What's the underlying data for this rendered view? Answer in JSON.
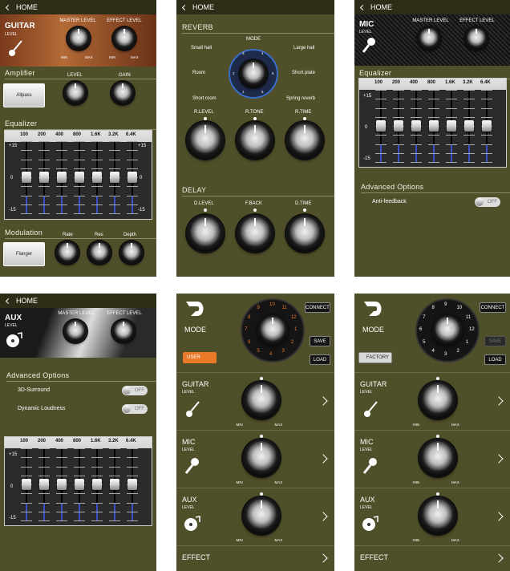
{
  "home": "HOME",
  "level": "LEVEL",
  "min": "MIN",
  "max": "MAX",
  "eq_bands": [
    "100",
    "200",
    "400",
    "800",
    "1.6K",
    "3.2K",
    "6.4K"
  ],
  "eq_scale": [
    "+15",
    "0",
    "-15"
  ],
  "eq_levels": [
    0.5,
    0.5,
    0.5,
    0.5,
    0.5,
    0.5,
    0.5
  ],
  "guitar": {
    "title": "GUITAR",
    "master": "MASTER LEVEL",
    "effect": "EFFECT LEVEL",
    "amplifier": "Amplifier",
    "amp_preset": "Allpass",
    "level_k": "LEVEL",
    "gain_k": "GAIN",
    "equalizer": "Equalizer",
    "modulation": "Modulation",
    "mod_preset": "Flanger",
    "rate": "Rate",
    "res": "Res",
    "depth": "Depth"
  },
  "reverb": {
    "title": "REVERB",
    "mode": "MODE",
    "modes": [
      "Small hall",
      "Large hall",
      "Room",
      "Short plate",
      "Short room",
      "Spring reverb"
    ],
    "dial": [
      "1",
      "2",
      "3",
      "4",
      "5",
      "6"
    ],
    "rlevel": "R.LEVEL",
    "rtone": "R.TONE",
    "rtime": "R.TIME",
    "delay": "DELAY",
    "dlevel": "D.LEVEL",
    "fback": "F.BACK",
    "dtime": "D.TIME"
  },
  "mic": {
    "title": "MIC",
    "master": "MASTER LEVEL",
    "effect": "EFFECT LEVEL",
    "equalizer": "Equalizer",
    "adv": "Advanced Options",
    "anti": "Anti-feedback",
    "off": "OFF"
  },
  "aux": {
    "title": "AUX",
    "master": "MASTER LEVEL",
    "effect": "EFFECT LEVEL",
    "adv": "Advanced Options",
    "surround": "3D-Surround",
    "loudness": "Dynamic Loudness",
    "off": "OFF"
  },
  "main_user": {
    "mode": "MODE",
    "connect": "CONNECT",
    "save": "SAVE",
    "load": "LOAD",
    "user": "USER",
    "dial": [
      "10",
      "11",
      "12",
      "1",
      "2",
      "3",
      "4",
      "5",
      "6",
      "7",
      "8",
      "9"
    ],
    "rows": [
      "GUITAR",
      "MIC",
      "AUX"
    ],
    "effect": "EFFECT"
  },
  "main_factory": {
    "mode": "MODE",
    "connect": "CONNECT",
    "save": "SAVE",
    "load": "LOAD",
    "factory": "FACTORY",
    "dial": [
      "9",
      "10",
      "11",
      "12",
      "1",
      "2",
      "3",
      "4",
      "5",
      "6",
      "7",
      "8"
    ],
    "rows": [
      "GUITAR",
      "MIC",
      "AUX"
    ],
    "effect": "EFFECT"
  },
  "colors": {
    "panel": "#4f4f2a",
    "bar": "#2d2d17",
    "accent": "#e87a2a",
    "blue": "#3a4fc8"
  }
}
